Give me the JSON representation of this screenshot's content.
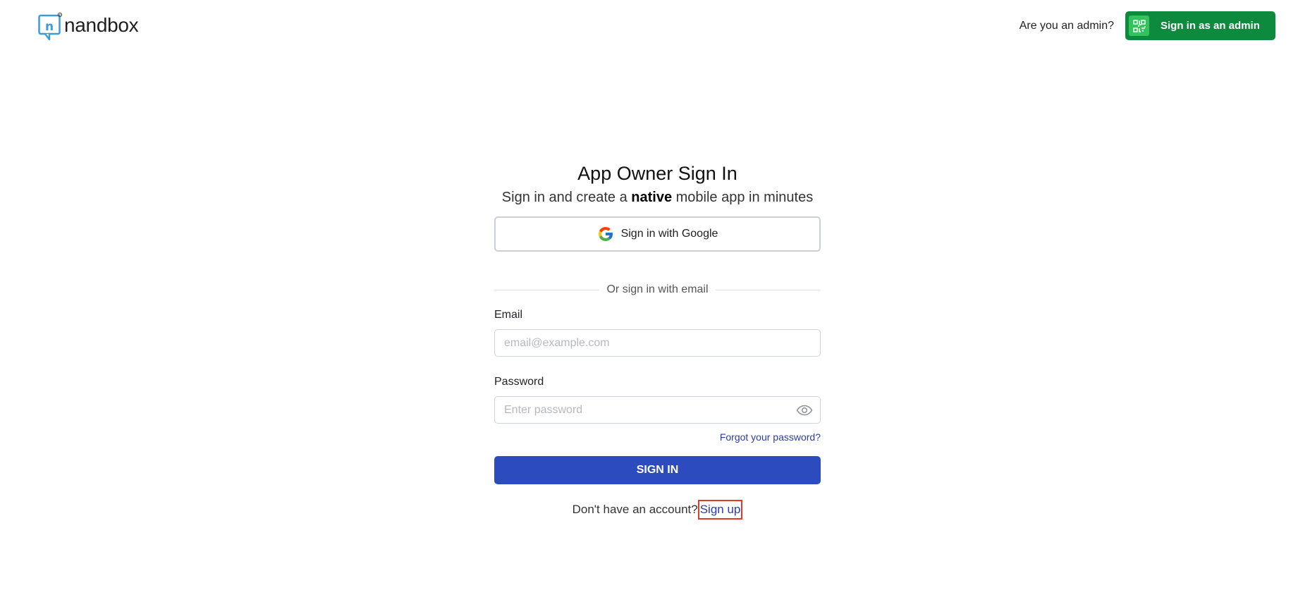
{
  "header": {
    "logo_text": "nandbox",
    "admin_question": "Are you an admin?",
    "admin_button_label": "Sign in as an admin",
    "admin_button_icon": "qr-code-icon",
    "colors": {
      "admin_button": "#0e8a3e",
      "qr_box": "#34c25c"
    }
  },
  "signin": {
    "title": "App Owner Sign In",
    "subtitle_pre": "Sign in and create a",
    "subtitle_bold": "native",
    "subtitle_post": "mobile app in minutes",
    "google_button_label": "Sign in with Google",
    "divider_text": "Or sign in with email",
    "email_label": "Email",
    "email_placeholder": "email@example.com",
    "email_value": "",
    "password_label": "Password",
    "password_placeholder": "Enter password",
    "password_value": "",
    "forgot_link": "Forgot your password?",
    "submit_label": "SIGN IN",
    "no_account_text": "Don't have an account?",
    "signup_link": "Sign up",
    "colors": {
      "primary": "#2b4bbf",
      "link": "#2c3e9c",
      "highlight": "#e03a2d"
    }
  }
}
